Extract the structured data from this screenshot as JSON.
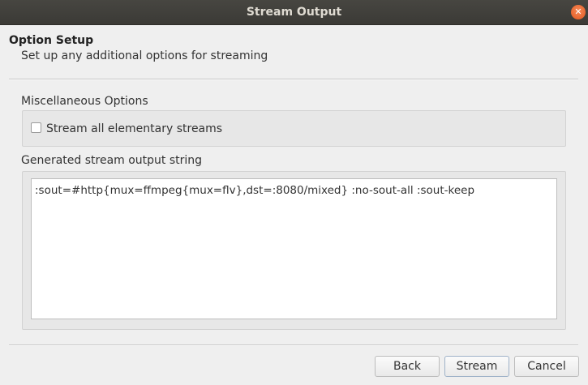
{
  "window": {
    "title": "Stream Output",
    "close_glyph": "✕"
  },
  "page": {
    "title": "Option Setup",
    "subtitle": "Set up any additional options for streaming"
  },
  "misc": {
    "label": "Miscellaneous Options",
    "stream_all_label": "Stream all elementary streams",
    "stream_all_checked": false
  },
  "output": {
    "label": "Generated stream output string",
    "value": ":sout=#http{mux=ffmpeg{mux=flv},dst=:8080/mixed} :no-sout-all :sout-keep"
  },
  "buttons": {
    "back": "Back",
    "stream": "Stream",
    "cancel": "Cancel"
  }
}
